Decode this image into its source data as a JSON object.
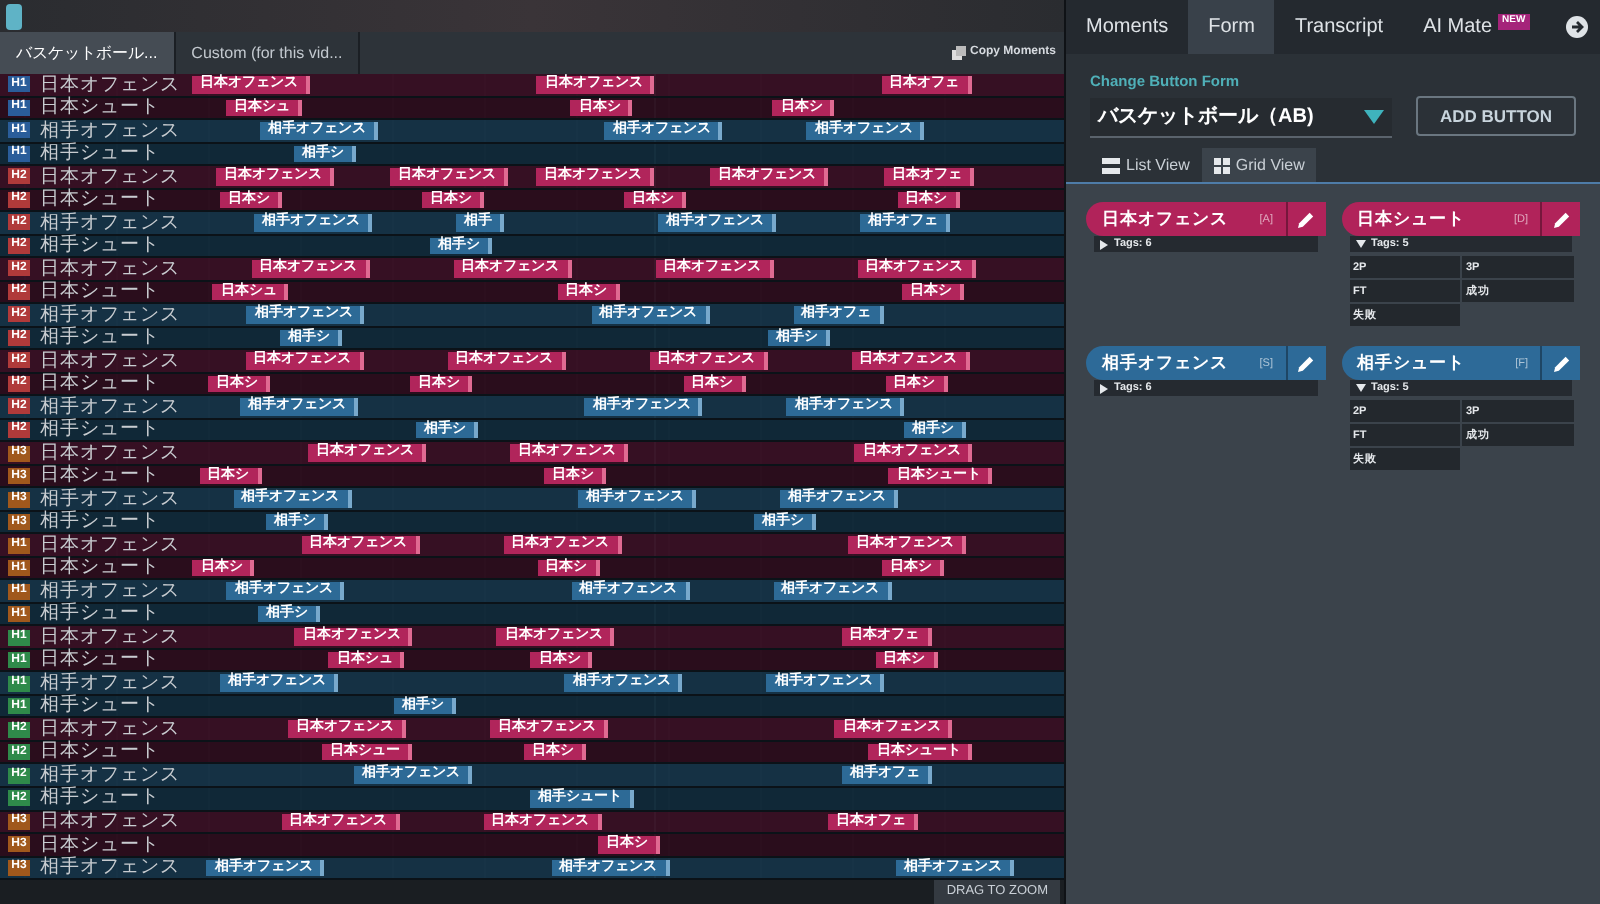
{
  "source_tabs": [
    {
      "label": "バスケットボール...",
      "selected": true
    },
    {
      "label": "Custom (for this vid...",
      "selected": false
    }
  ],
  "copy_button": "Copy Moments",
  "timeline_rows": [
    {
      "kind": "home",
      "label": "日本オフェンス",
      "badge": "H1",
      "color": "#2a5d9a",
      "clips": [
        "日本オフェンス",
        "日本オフェンス",
        "日本オフェ"
      ]
    },
    {
      "kind": "home",
      "label": "日本シュート",
      "badge": "H1",
      "color": "#2a5d9a",
      "clips": [
        "日本シュ",
        "日本シ",
        "日本シ"
      ]
    },
    {
      "kind": "away",
      "label": "相手オフェンス",
      "badge": "H1",
      "color": "#2a5d9a",
      "clips": [
        "相手オフェンス",
        "相手オフェンス",
        "相手オフェンス"
      ]
    },
    {
      "kind": "away",
      "label": "相手シュート",
      "badge": "H1",
      "color": "#2a5d9a",
      "clips": [
        "相手シ"
      ]
    },
    {
      "kind": "home",
      "label": "日本オフェンス",
      "badge": "H2",
      "color": "#b03a3a",
      "clips": [
        "日本オフェンス",
        "日本オフェンス",
        "日本オフェンス",
        "日本オフェンス",
        "日本オフェ"
      ]
    },
    {
      "kind": "home",
      "label": "日本シュート",
      "badge": "H2",
      "color": "#b03a3a",
      "clips": [
        "日本シ",
        "日本シ",
        "日本シ",
        "日本シ"
      ]
    },
    {
      "kind": "away",
      "label": "相手オフェンス",
      "badge": "H2",
      "color": "#b03a3a",
      "clips": [
        "相手オフェンス",
        "相手",
        "相手オフェンス",
        "相手オフェ"
      ]
    },
    {
      "kind": "away",
      "label": "相手シュート",
      "badge": "H2",
      "color": "#b03a3a",
      "clips": [
        "相手シ"
      ]
    },
    {
      "kind": "home",
      "label": "日本オフェンス",
      "badge": "H2",
      "color": "#b03a3a",
      "clips": [
        "日本オフェンス",
        "日本オフェンス",
        "日本オフェンス",
        "日本オフェンス"
      ]
    },
    {
      "kind": "home",
      "label": "日本シュート",
      "badge": "H2",
      "color": "#b03a3a",
      "clips": [
        "日本シュ",
        "日本シ",
        "日本シ"
      ]
    },
    {
      "kind": "away",
      "label": "相手オフェンス",
      "badge": "H2",
      "color": "#b03a3a",
      "clips": [
        "相手オフェンス",
        "相手オフェンス",
        "相手オフェ"
      ]
    },
    {
      "kind": "away",
      "label": "相手シュート",
      "badge": "H2",
      "color": "#b03a3a",
      "clips": [
        "相手シ",
        "相手シ"
      ]
    },
    {
      "kind": "home",
      "label": "日本オフェンス",
      "badge": "H2",
      "color": "#b03a3a",
      "clips": [
        "日本オフェンス",
        "日本オフェンス",
        "日本オフェンス",
        "日本オフェンス"
      ]
    },
    {
      "kind": "home",
      "label": "日本シュート",
      "badge": "H2",
      "color": "#b03a3a",
      "clips": [
        "日本シ",
        "日本シ",
        "日本シ",
        "日本シ"
      ]
    },
    {
      "kind": "away",
      "label": "相手オフェンス",
      "badge": "H2",
      "color": "#b03a3a",
      "clips": [
        "相手オフェンス",
        "相手オフェンス",
        "相手オフェンス"
      ]
    },
    {
      "kind": "away",
      "label": "相手シュート",
      "badge": "H2",
      "color": "#b03a3a",
      "clips": [
        "相手シ",
        "相手シ"
      ]
    },
    {
      "kind": "home",
      "label": "日本オフェンス",
      "badge": "H3",
      "color": "#a0581c",
      "clips": [
        "日本オフェンス",
        "日本オフェンス",
        "日本オフェンス"
      ]
    },
    {
      "kind": "home",
      "label": "日本シュート",
      "badge": "H3",
      "color": "#a0581c",
      "clips": [
        "日本シ",
        "日本シ",
        "日本シュート"
      ]
    },
    {
      "kind": "away",
      "label": "相手オフェンス",
      "badge": "H3",
      "color": "#a0581c",
      "clips": [
        "相手オフェンス",
        "相手オフェンス",
        "相手オフェンス"
      ]
    },
    {
      "kind": "away",
      "label": "相手シュート",
      "badge": "H3",
      "color": "#a0581c",
      "clips": [
        "相手シ",
        "相手シ"
      ]
    },
    {
      "kind": "home",
      "label": "日本オフェンス",
      "badge": "H1",
      "color": "#a0581c",
      "clips": [
        "日本オフェンス",
        "日本オフェンス",
        "日本オフェンス"
      ]
    },
    {
      "kind": "home",
      "label": "日本シュート",
      "badge": "H1",
      "color": "#a0581c",
      "clips": [
        "日本シ",
        "日本シ",
        "日本シ"
      ]
    },
    {
      "kind": "away",
      "label": "相手オフェンス",
      "badge": "H1",
      "color": "#a0581c",
      "clips": [
        "相手オフェンス",
        "相手オフェンス",
        "相手オフェンス"
      ]
    },
    {
      "kind": "away",
      "label": "相手シュート",
      "badge": "H1",
      "color": "#a0581c",
      "clips": [
        "相手シ"
      ]
    },
    {
      "kind": "home",
      "label": "日本オフェンス",
      "badge": "H1",
      "color": "#2f8a4a",
      "clips": [
        "日本オフェンス",
        "日本オフェンス",
        "日本オフェ"
      ]
    },
    {
      "kind": "home",
      "label": "日本シュート",
      "badge": "H1",
      "color": "#2f8a4a",
      "clips": [
        "日本シュ",
        "日本シ",
        "日本シ"
      ]
    },
    {
      "kind": "away",
      "label": "相手オフェンス",
      "badge": "H1",
      "color": "#2f8a4a",
      "clips": [
        "相手オフェンス",
        "相手オフェンス",
        "相手オフェンス"
      ]
    },
    {
      "kind": "away",
      "label": "相手シュート",
      "badge": "H1",
      "color": "#2f8a4a",
      "clips": [
        "相手シ"
      ]
    },
    {
      "kind": "home",
      "label": "日本オフェンス",
      "badge": "H2",
      "color": "#2f8a4a",
      "clips": [
        "日本オフェンス",
        "日本オフェンス",
        "日本オフェンス"
      ]
    },
    {
      "kind": "home",
      "label": "日本シュート",
      "badge": "H2",
      "color": "#2f8a4a",
      "clips": [
        "日本シュー",
        "日本シ",
        "日本シュート"
      ]
    },
    {
      "kind": "away",
      "label": "相手オフェンス",
      "badge": "H2",
      "color": "#2f8a4a",
      "clips": [
        "相手オフェンス",
        "相手オフェ"
      ]
    },
    {
      "kind": "away",
      "label": "相手シュート",
      "badge": "H2",
      "color": "#2f8a4a",
      "clips": [
        "相手シュート"
      ]
    },
    {
      "kind": "home",
      "label": "日本オフェンス",
      "badge": "H3",
      "color": "#a0581c",
      "clips": [
        "日本オフェンス",
        "日本オフェンス",
        "日本オフェ"
      ]
    },
    {
      "kind": "home",
      "label": "日本シュート",
      "badge": "H3",
      "color": "#a0581c",
      "clips": [
        "日本シ"
      ]
    },
    {
      "kind": "away",
      "label": "相手オフェンス",
      "badge": "H3",
      "color": "#a0581c",
      "clips": [
        "相手オフェンス",
        "相手オフェンス",
        "相手オフェンス"
      ]
    }
  ],
  "zoom_hint": "DRAG TO ZOOM",
  "panel_tabs": [
    {
      "label": "Moments",
      "selected": false
    },
    {
      "label": "Form",
      "selected": true
    },
    {
      "label": "Transcript",
      "selected": false
    },
    {
      "label": "AI Mate",
      "selected": false,
      "badge": "NEW"
    }
  ],
  "form": {
    "caption": "Change Button Form",
    "value": "バスケットボール（AB)",
    "add_button": "ADD BUTTON"
  },
  "view_tabs": [
    {
      "label": "List View",
      "selected": false
    },
    {
      "label": "Grid View",
      "selected": true
    }
  ],
  "buttons": [
    {
      "kind": "home",
      "label": "日本オフェンス",
      "key": "[A]",
      "tags_label": "Tags: 6",
      "expanded": false
    },
    {
      "kind": "home",
      "label": "日本シュート",
      "key": "[D]",
      "tags_label": "Tags: 5",
      "expanded": true,
      "tags": [
        "2P",
        "3P",
        "FT",
        "成功",
        "失敗"
      ]
    },
    {
      "kind": "away",
      "label": "相手オフェンス",
      "key": "[S]",
      "tags_label": "Tags: 6",
      "expanded": false
    },
    {
      "kind": "away",
      "label": "相手シュート",
      "key": "[F]",
      "tags_label": "Tags: 5",
      "expanded": true,
      "tags": [
        "2P",
        "3P",
        "FT",
        "成功",
        "失敗"
      ]
    }
  ]
}
